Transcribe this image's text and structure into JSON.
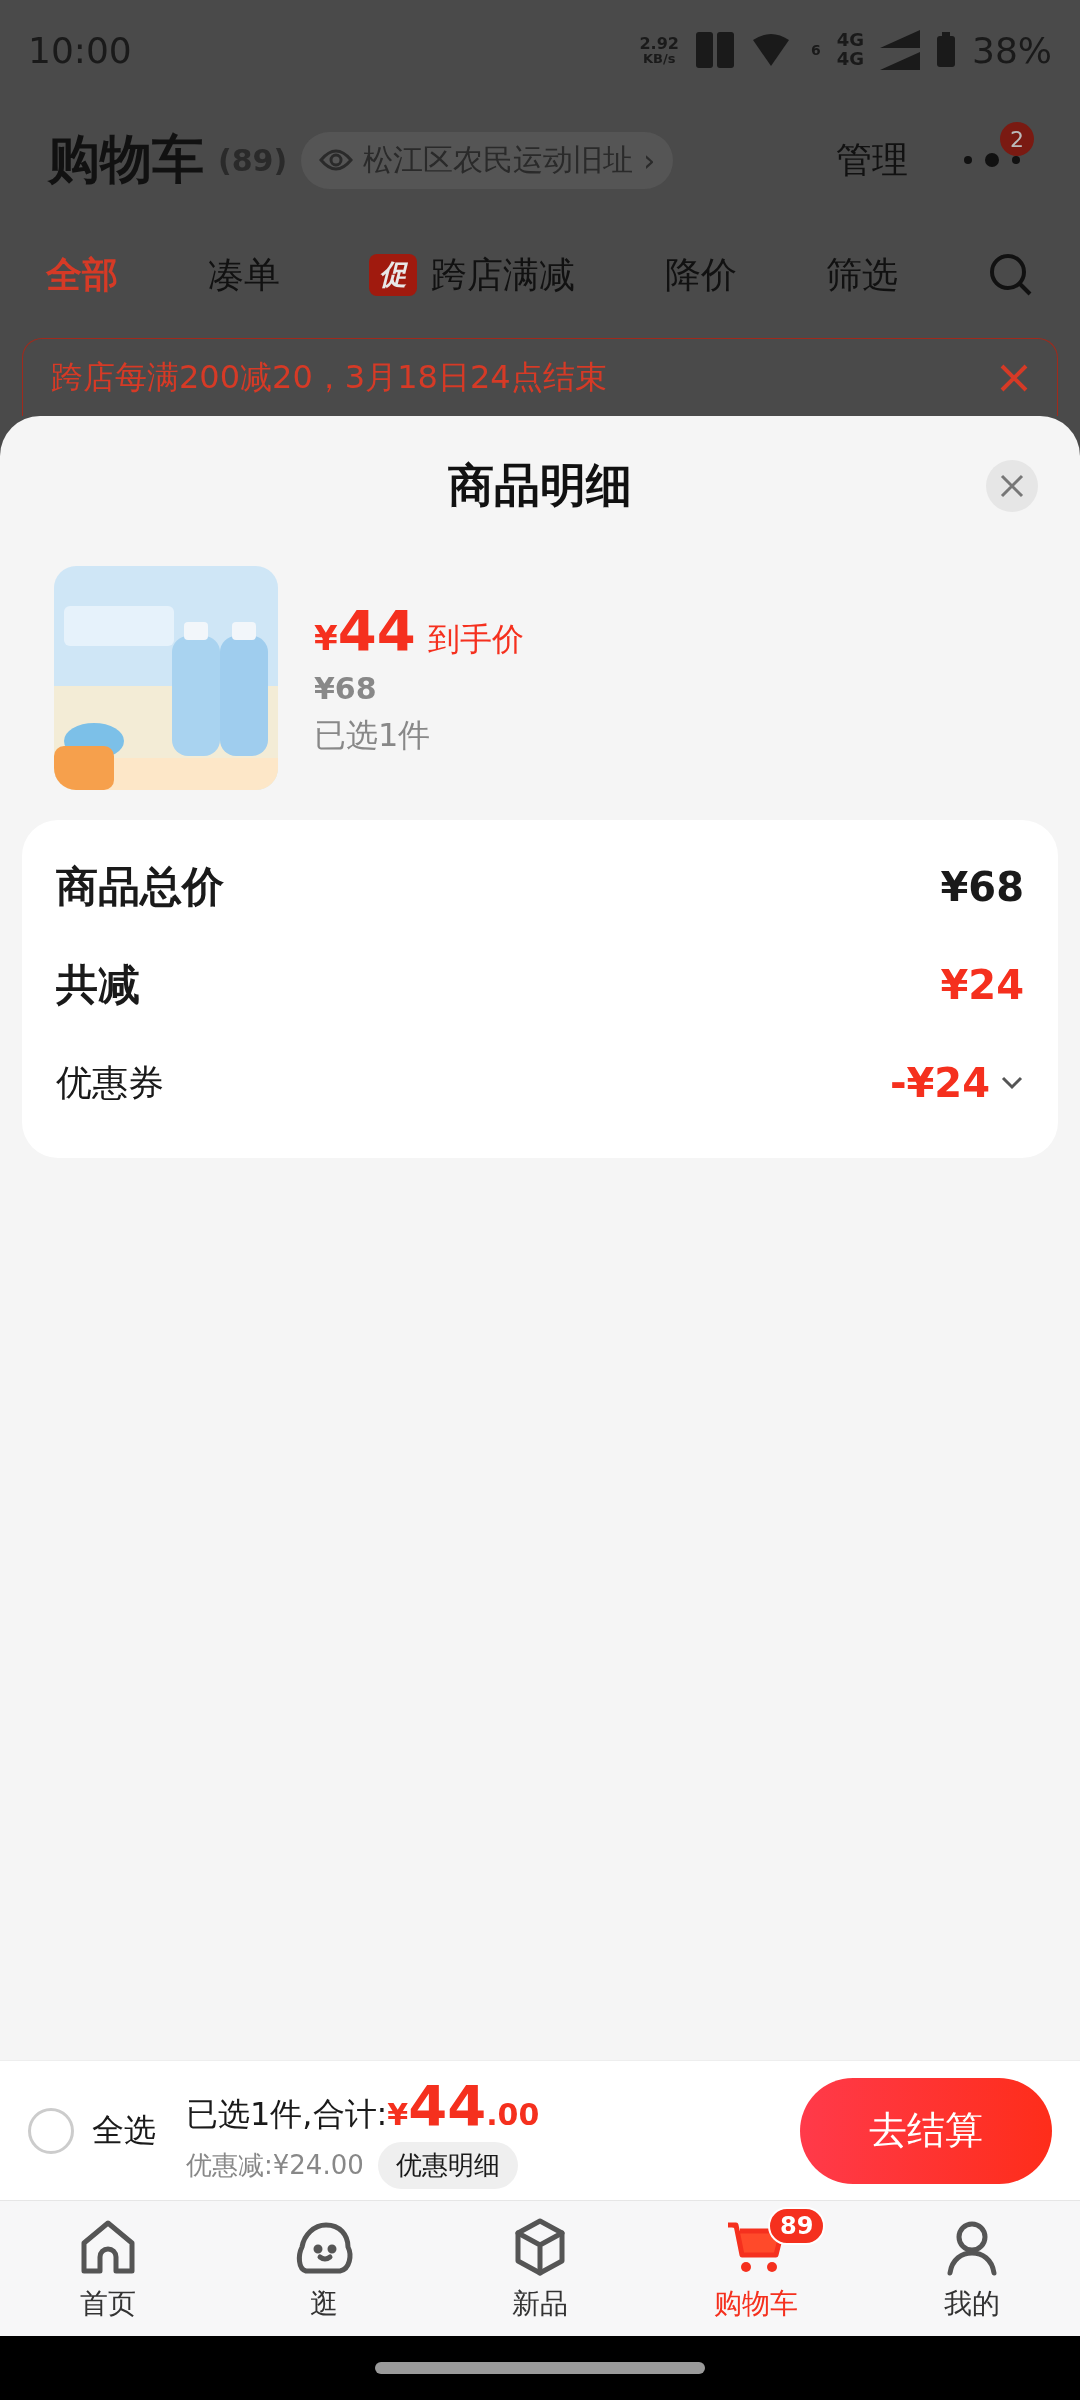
{
  "status_bar": {
    "time": "10:00",
    "speed": "2.92",
    "speed_unit": "KB/s",
    "sim_mark": "6",
    "network_top": "4G",
    "network_bottom": "4G",
    "battery": "38%"
  },
  "header": {
    "title": "购物车",
    "count": "(89)",
    "location": "松江区农民运动旧址",
    "location_arrow": "›",
    "manage": "管理",
    "more_badge": "2"
  },
  "tabs": [
    {
      "label": "全部",
      "selected": true
    },
    {
      "label": "凑单",
      "selected": false
    },
    {
      "label": "跨店满减",
      "tag": "促",
      "selected": false
    },
    {
      "label": "降价",
      "selected": false
    },
    {
      "label": "筛选",
      "selected": false
    }
  ],
  "banner": {
    "text": "跨店每满200减20，3月18日24点结束"
  },
  "sheet": {
    "title": "商品明细",
    "product": {
      "currency": "¥",
      "price": "44",
      "price_label": "到手价",
      "original_price": "¥68",
      "selected_count": "已选1件"
    },
    "summary": [
      {
        "kind": "total",
        "label": "商品总价",
        "value": "¥68"
      },
      {
        "kind": "discount",
        "label": "共减",
        "value": "¥24"
      },
      {
        "kind": "coupon",
        "label": "优惠券",
        "value": "-¥24"
      }
    ]
  },
  "bottom_bar": {
    "select_all": {
      "label": "全选",
      "checked": false
    },
    "summary": "已选1件,合计:",
    "currency": "¥",
    "amount": "44",
    "decimals": ".00",
    "discount": "优惠减:¥24.00",
    "detail_button": "优惠明细",
    "checkout": "去结算"
  },
  "nav": [
    {
      "kind": "home",
      "label": "首页",
      "selected": false
    },
    {
      "kind": "explore",
      "label": "逛",
      "selected": false
    },
    {
      "kind": "new",
      "label": "新品",
      "selected": false
    },
    {
      "kind": "cart",
      "label": "购物车",
      "badge": "89",
      "selected": true
    },
    {
      "kind": "profile",
      "label": "我的",
      "selected": false
    }
  ]
}
